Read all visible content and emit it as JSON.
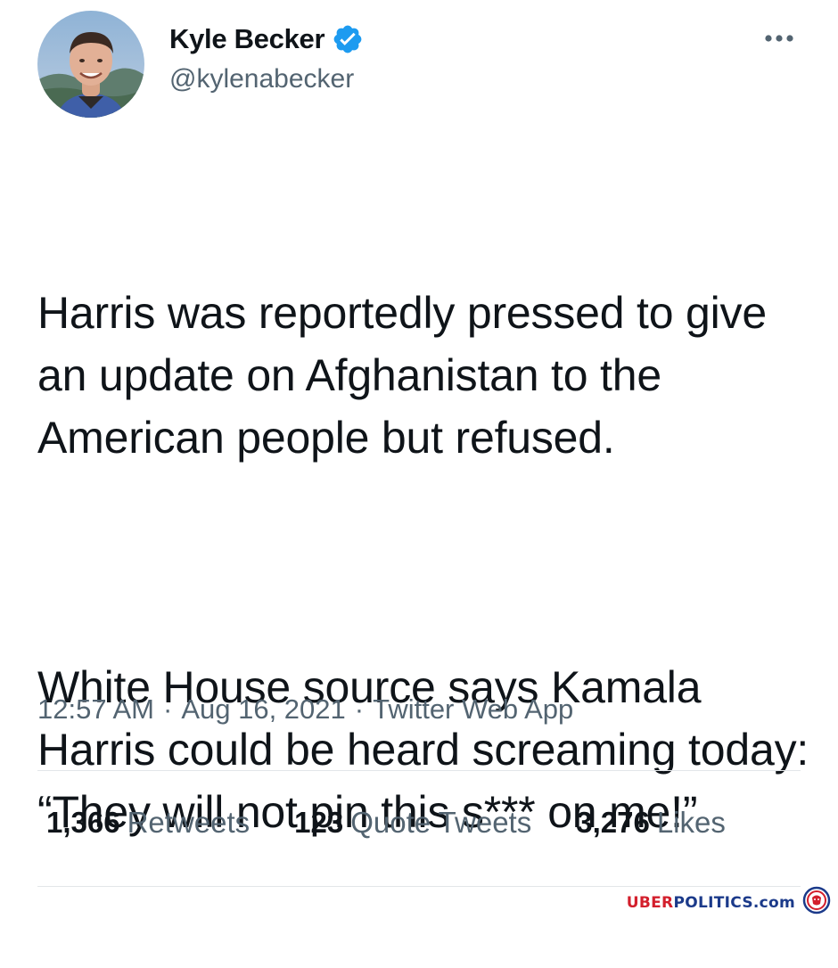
{
  "author": {
    "display_name": "Kyle Becker",
    "handle": "@kylenabecker",
    "verified_icon": "verified-badge-icon",
    "avatar_icon": "avatar"
  },
  "menu": {
    "more_icon": "more-options-icon"
  },
  "tweet": {
    "paragraph_1": "Harris was reportedly pressed to give an update on Afghanistan to the American people but refused.",
    "paragraph_2": "White House source says Kamala Harris could be heard screaming today: “They will not pin this s*** on me!”"
  },
  "meta": {
    "time": "12:57 AM",
    "separator": "·",
    "date": "Aug 16, 2021",
    "source": "Twitter Web App"
  },
  "stats": {
    "retweets_count": "1,366",
    "retweets_label": "Retweets",
    "quotes_count": "123",
    "quotes_label": "Quote Tweets",
    "likes_count": "3,276",
    "likes_label": "Likes"
  },
  "watermark": {
    "part_1": "UBER",
    "part_2": "POLITICS.com",
    "logo_icon": "lion-logo-icon"
  },
  "colors": {
    "text_primary": "#0f1419",
    "text_secondary": "#536471",
    "verified_blue": "#1d9bf0",
    "divider": "#e3e6e9",
    "watermark_red": "#d31f2c",
    "watermark_blue": "#1b3a8a"
  }
}
